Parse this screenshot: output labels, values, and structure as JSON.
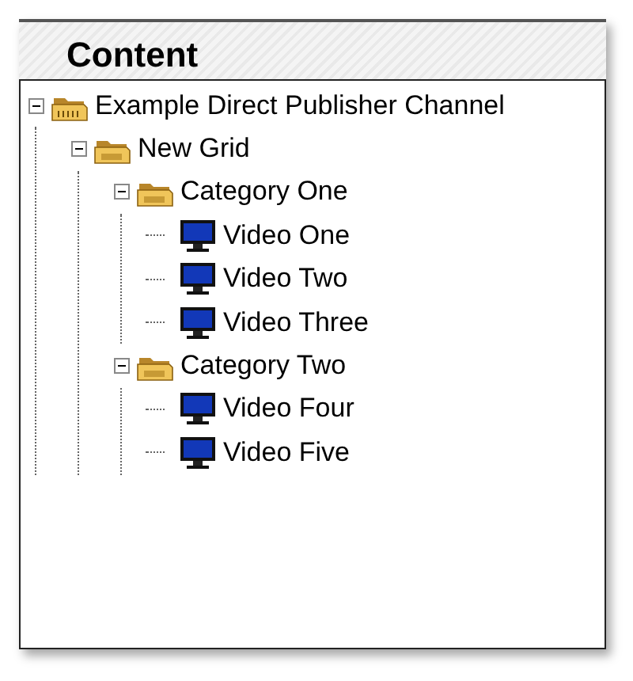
{
  "panel": {
    "title": "Content"
  },
  "tree": [
    {
      "label": "Example Direct Publisher Channel",
      "kind": "channel",
      "expanded": true,
      "children": [
        {
          "label": "New Grid",
          "kind": "folder",
          "expanded": true,
          "children": [
            {
              "label": "Category One",
              "kind": "folder",
              "expanded": true,
              "children": [
                {
                  "label": "Video One",
                  "kind": "video"
                },
                {
                  "label": "Video Two",
                  "kind": "video"
                },
                {
                  "label": "Video Three",
                  "kind": "video"
                }
              ]
            },
            {
              "label": "Category Two",
              "kind": "folder",
              "expanded": true,
              "children": [
                {
                  "label": "Video Four",
                  "kind": "video"
                },
                {
                  "label": "Video Five",
                  "kind": "video"
                }
              ]
            }
          ]
        }
      ]
    }
  ]
}
